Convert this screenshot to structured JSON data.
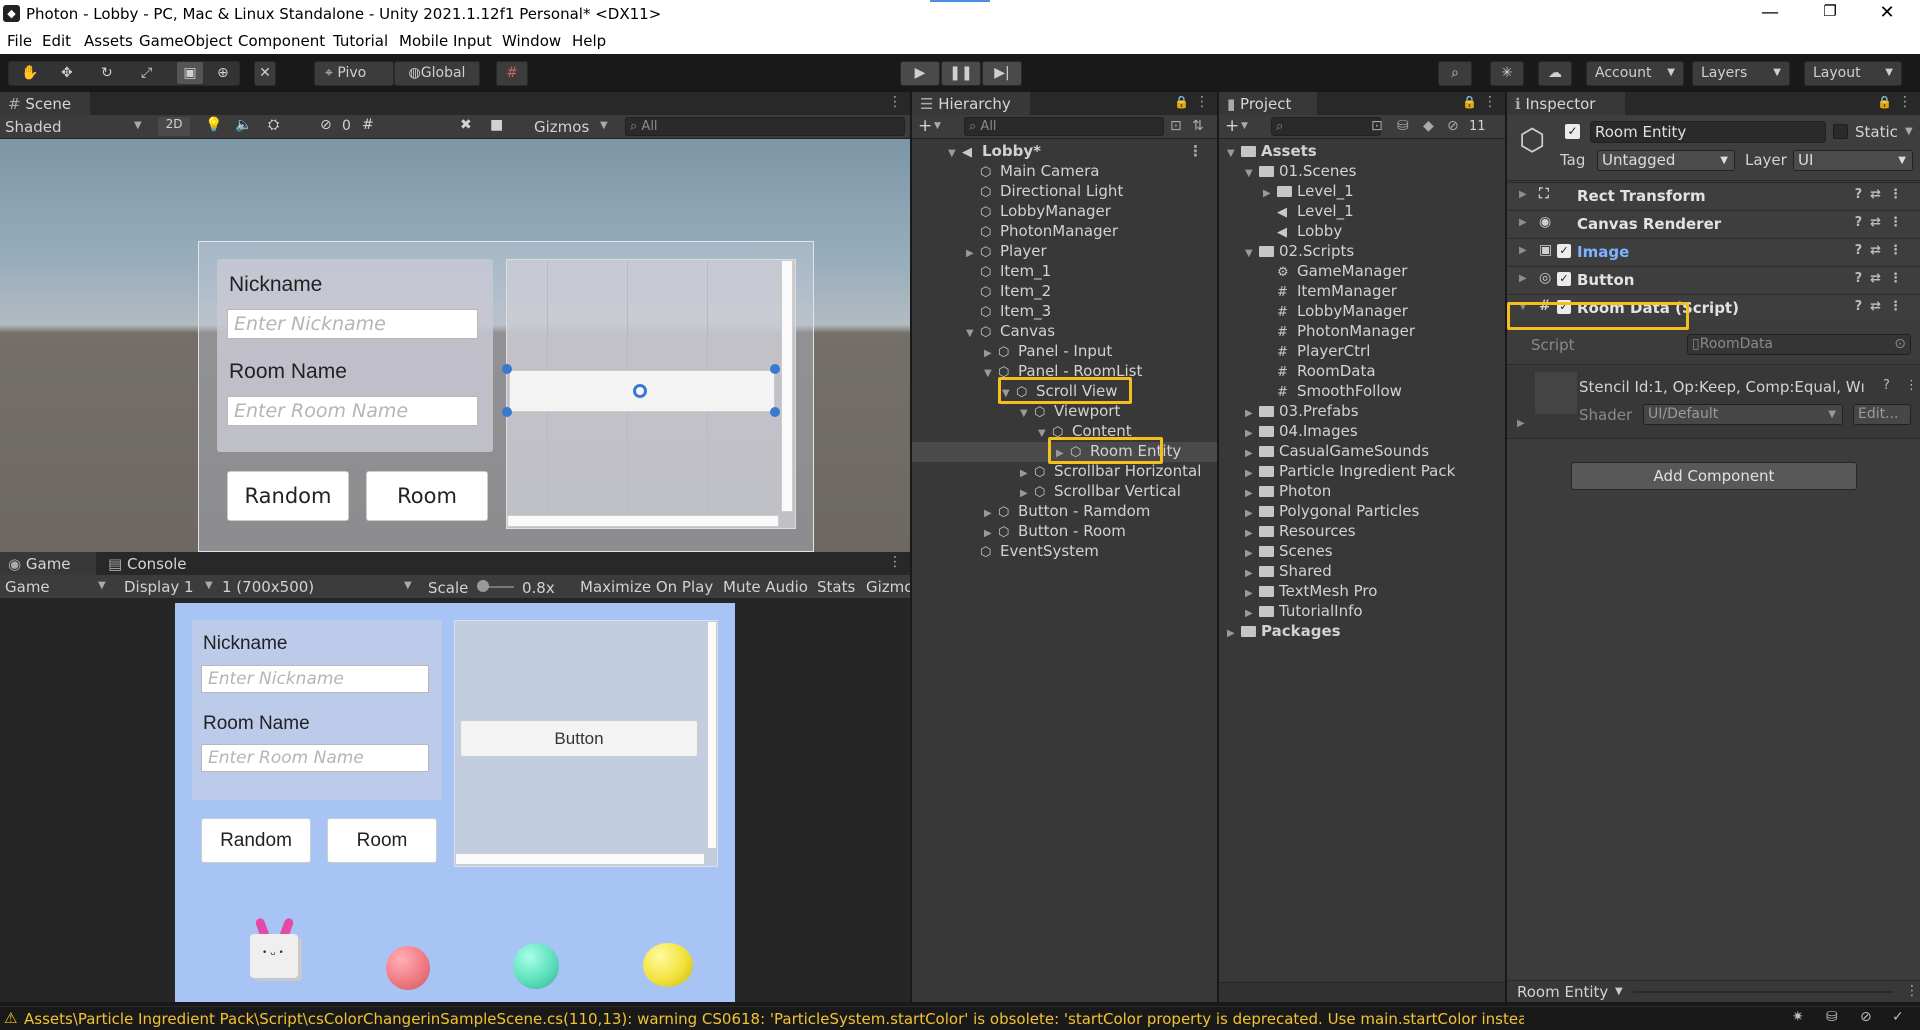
{
  "window": {
    "title": "Photon - Lobby - PC, Mac & Linux Standalone - Unity 2021.1.12f1 Personal* <DX11>",
    "minimize": "—",
    "restore": "❐",
    "close": "✕"
  },
  "menu": [
    "File",
    "Edit",
    "Assets",
    "GameObject",
    "Component",
    "Tutorial",
    "Mobile Input",
    "Window",
    "Help"
  ],
  "toolbar": {
    "pivot": "Pivo",
    "global": "Global",
    "account": "Account",
    "layers": "Layers",
    "layout": "Layout"
  },
  "scene": {
    "tab": "Scene",
    "shading": "Shaded",
    "mode2d": "2D",
    "hidden_count": "0",
    "gizmos": "Gizmos",
    "search_placeholder": "All",
    "ui": {
      "nickname_label": "Nickname",
      "nickname_placeholder": "Enter Nickname",
      "room_label": "Room Name",
      "room_placeholder": "Enter Room Name",
      "random_btn": "Random",
      "room_btn": "Room"
    }
  },
  "game": {
    "tab": "Game",
    "console_tab": "Console",
    "mode": "Game",
    "display": "Display 1",
    "resolution": "1 (700x500)",
    "scale_label": "Scale",
    "scale_value": "0.8x",
    "maximize": "Maximize On Play",
    "mute": "Mute Audio",
    "stats": "Stats",
    "gizmos": "Gizmo",
    "ui": {
      "nickname_label": "Nickname",
      "nickname_placeholder": "Enter Nickname",
      "room_label": "Room Name",
      "room_placeholder": "Enter Room Name",
      "random_btn": "Random",
      "room_btn": "Room",
      "list_button": "Button"
    },
    "colors": {
      "background": "#a8c4f4",
      "ball_pink": "#f07a82",
      "ball_teal": "#5ee0bc",
      "ball_yellow": "#f2e23a"
    }
  },
  "hierarchy": {
    "tab": "Hierarchy",
    "search_placeholder": "All",
    "items": [
      {
        "label": "Lobby*",
        "level": 0,
        "bold": true,
        "arrow": "▼",
        "icon": "scene-icon"
      },
      {
        "label": "Main Camera",
        "level": 1
      },
      {
        "label": "Directional Light",
        "level": 1
      },
      {
        "label": "LobbyManager",
        "level": 1
      },
      {
        "label": "PhotonManager",
        "level": 1
      },
      {
        "label": "Player",
        "level": 1,
        "arrow": "▶"
      },
      {
        "label": "Item_1",
        "level": 1
      },
      {
        "label": "Item_2",
        "level": 1
      },
      {
        "label": "Item_3",
        "level": 1
      },
      {
        "label": "Canvas",
        "level": 1,
        "arrow": "▼"
      },
      {
        "label": "Panel - Input",
        "level": 2,
        "arrow": "▶"
      },
      {
        "label": "Panel - RoomList",
        "level": 2,
        "arrow": "▼"
      },
      {
        "label": "Scroll View",
        "level": 3,
        "arrow": "▼"
      },
      {
        "label": "Viewport",
        "level": 4,
        "arrow": "▼"
      },
      {
        "label": "Content",
        "level": 5,
        "arrow": "▼"
      },
      {
        "label": "Room Entity",
        "level": 6,
        "arrow": "▶",
        "selected": true
      },
      {
        "label": "Scrollbar Horizontal",
        "level": 4,
        "arrow": "▶"
      },
      {
        "label": "Scrollbar Vertical",
        "level": 4,
        "arrow": "▶"
      },
      {
        "label": "Button - Ramdom",
        "level": 2,
        "arrow": "▶"
      },
      {
        "label": "Button - Room",
        "level": 2,
        "arrow": "▶"
      },
      {
        "label": "EventSystem",
        "level": 1
      }
    ]
  },
  "project": {
    "tab": "Project",
    "hidden_count": "11",
    "items": [
      {
        "label": "Assets",
        "level": 0,
        "arrow": "▼",
        "type": "folder",
        "bold": true
      },
      {
        "label": "01.Scenes",
        "level": 1,
        "arrow": "▼",
        "type": "folder"
      },
      {
        "label": "Level_1",
        "level": 2,
        "arrow": "▶",
        "type": "folder"
      },
      {
        "label": "Level_1",
        "level": 2,
        "type": "scene"
      },
      {
        "label": "Lobby",
        "level": 2,
        "type": "scene"
      },
      {
        "label": "02.Scripts",
        "level": 1,
        "arrow": "▼",
        "type": "folder"
      },
      {
        "label": "GameManager",
        "level": 2,
        "type": "gear"
      },
      {
        "label": "ItemManager",
        "level": 2,
        "type": "script"
      },
      {
        "label": "LobbyManager",
        "level": 2,
        "type": "script"
      },
      {
        "label": "PhotonManager",
        "level": 2,
        "type": "script"
      },
      {
        "label": "PlayerCtrl",
        "level": 2,
        "type": "script"
      },
      {
        "label": "RoomData",
        "level": 2,
        "type": "script"
      },
      {
        "label": "SmoothFollow",
        "level": 2,
        "type": "script"
      },
      {
        "label": "03.Prefabs",
        "level": 1,
        "arrow": "▶",
        "type": "folder"
      },
      {
        "label": "04.Images",
        "level": 1,
        "arrow": "▶",
        "type": "folder"
      },
      {
        "label": "CasualGameSounds",
        "level": 1,
        "arrow": "▶",
        "type": "folder"
      },
      {
        "label": "Particle Ingredient Pack",
        "level": 1,
        "arrow": "▶",
        "type": "folder"
      },
      {
        "label": "Photon",
        "level": 1,
        "arrow": "▶",
        "type": "folder"
      },
      {
        "label": "Polygonal Particles",
        "level": 1,
        "arrow": "▶",
        "type": "folder"
      },
      {
        "label": "Resources",
        "level": 1,
        "arrow": "▶",
        "type": "folder"
      },
      {
        "label": "Scenes",
        "level": 1,
        "arrow": "▶",
        "type": "folder"
      },
      {
        "label": "Shared",
        "level": 1,
        "arrow": "▶",
        "type": "folder"
      },
      {
        "label": "TextMesh Pro",
        "level": 1,
        "arrow": "▶",
        "type": "folder"
      },
      {
        "label": "TutorialInfo",
        "level": 1,
        "arrow": "▶",
        "type": "folder"
      },
      {
        "label": "Packages",
        "level": 0,
        "arrow": "▶",
        "type": "folder",
        "bold": true
      }
    ]
  },
  "inspector": {
    "tab": "Inspector",
    "object_name": "Room Entity",
    "static_label": "Static",
    "tag_label": "Tag",
    "tag_value": "Untagged",
    "layer_label": "Layer",
    "layer_value": "UI",
    "components": [
      {
        "label": "Rect Transform",
        "icon": "rect-transform-icon",
        "check": false
      },
      {
        "label": "Canvas Renderer",
        "icon": "eye-icon",
        "check": false
      },
      {
        "label": "Image",
        "icon": "image-icon",
        "check": true,
        "accent": "#7fb3ff"
      },
      {
        "label": "Button",
        "icon": "button-icon",
        "check": true
      },
      {
        "label": "Room Data (Script)",
        "icon": "script-icon",
        "check": true,
        "expanded": true
      }
    ],
    "script_label": "Script",
    "script_value": "RoomData",
    "stencil": "Stencil Id:1, Op:Keep, Comp:Equal, Wı",
    "shader_label": "Shader",
    "shader_value": "UI/Default",
    "edit_btn": "Edit...",
    "add_component": "Add Component",
    "footer": "Room Entity"
  },
  "status": {
    "message": "Assets\\Particle Ingredient Pack\\Script\\csColorChangerinSampleScene.cs(110,13): warning CS0618: 'ParticleSystem.startColor' is obsolete: 'startColor property is deprecated. Use main.startColor instead.'",
    "warning_color": "#f2c230"
  }
}
